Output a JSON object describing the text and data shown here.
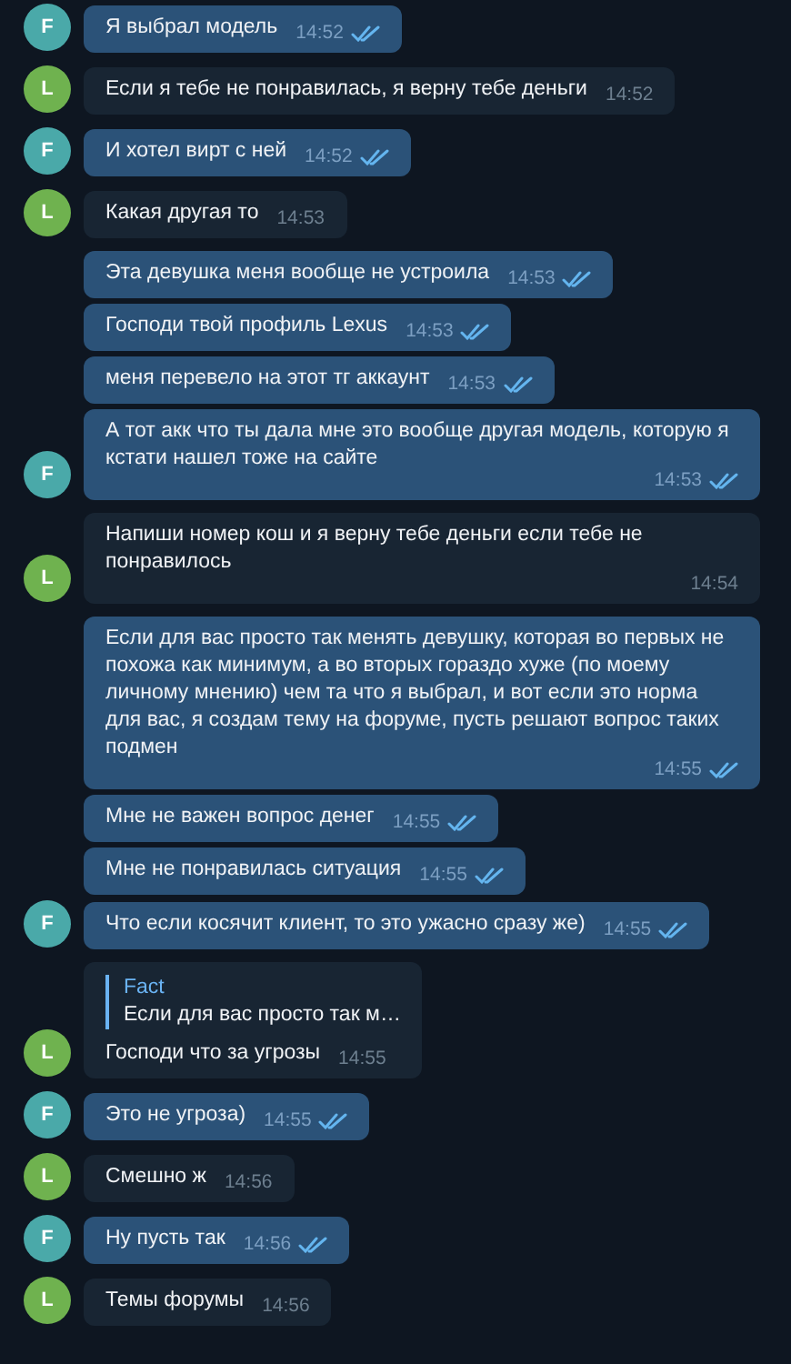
{
  "messages": [
    {
      "outgoing": true,
      "avatar": "F",
      "color": "#4aa9a9",
      "text": "Я выбрал модель",
      "time": "14:52",
      "read": true
    },
    {
      "outgoing": false,
      "avatar": "L",
      "color": "#6fb24f",
      "text": "Если я тебе не понравилась, я верну тебе деньги",
      "time": "14:52"
    },
    {
      "outgoing": true,
      "avatar": "F",
      "color": "#4aa9a9",
      "text": "И хотел вирт с ней",
      "time": "14:52",
      "read": true
    },
    {
      "outgoing": false,
      "avatar": "L",
      "color": "#6fb24f",
      "text": "Какая другая то",
      "time": "14:53"
    },
    {
      "outgoing": true,
      "text": "Эта девушка меня вообще не устроила",
      "time": "14:53",
      "read": true
    },
    {
      "outgoing": true,
      "text": "Господи твой профиль Lexus",
      "time": "14:53",
      "read": true
    },
    {
      "outgoing": true,
      "text": "меня перевело на этот тг аккаунт",
      "time": "14:53",
      "read": true
    },
    {
      "outgoing": true,
      "avatar": "F",
      "color": "#4aa9a9",
      "text": "А тот акк что ты дала мне это вообще другая модель, которую я кстати нашел тоже на сайте",
      "time": "14:53",
      "read": true
    },
    {
      "outgoing": false,
      "avatar": "L",
      "color": "#6fb24f",
      "text": "Напиши номер кош и я верну тебе деньги если тебе не понравилось",
      "time": "14:54"
    },
    {
      "outgoing": true,
      "text": "Если для вас просто так менять девушку, которая во первых не похожа как минимум, а во вторых гораздо хуже (по моему личному мнению) чем та что я выбрал, и вот если это норма для вас, я создам тему на форуме, пусть решают вопрос таких подмен",
      "time": "14:55",
      "read": true
    },
    {
      "outgoing": true,
      "text": "Мне не важен вопрос денег",
      "time": "14:55",
      "read": true
    },
    {
      "outgoing": true,
      "text": "Мне не понравилась ситуация",
      "time": "14:55",
      "read": true
    },
    {
      "outgoing": true,
      "avatar": "F",
      "color": "#4aa9a9",
      "text": "Что если косячит клиент, то это ужасно сразу же)",
      "time": "14:55",
      "read": true
    },
    {
      "outgoing": false,
      "avatar": "L",
      "color": "#6fb24f",
      "reply": {
        "author": "Fact",
        "text": "Если для вас просто так м…"
      },
      "text": "Господи что за угрозы",
      "time": "14:55"
    },
    {
      "outgoing": true,
      "avatar": "F",
      "color": "#4aa9a9",
      "text": "Это не угроза)",
      "time": "14:55",
      "read": true
    },
    {
      "outgoing": false,
      "avatar": "L",
      "color": "#6fb24f",
      "text": "Смешно ж",
      "time": "14:56"
    },
    {
      "outgoing": true,
      "avatar": "F",
      "color": "#4aa9a9",
      "text": "Ну пусть так",
      "time": "14:56",
      "read": true
    },
    {
      "outgoing": false,
      "avatar": "L",
      "color": "#6fb24f",
      "text": "Темы форумы",
      "time": "14:56"
    }
  ]
}
